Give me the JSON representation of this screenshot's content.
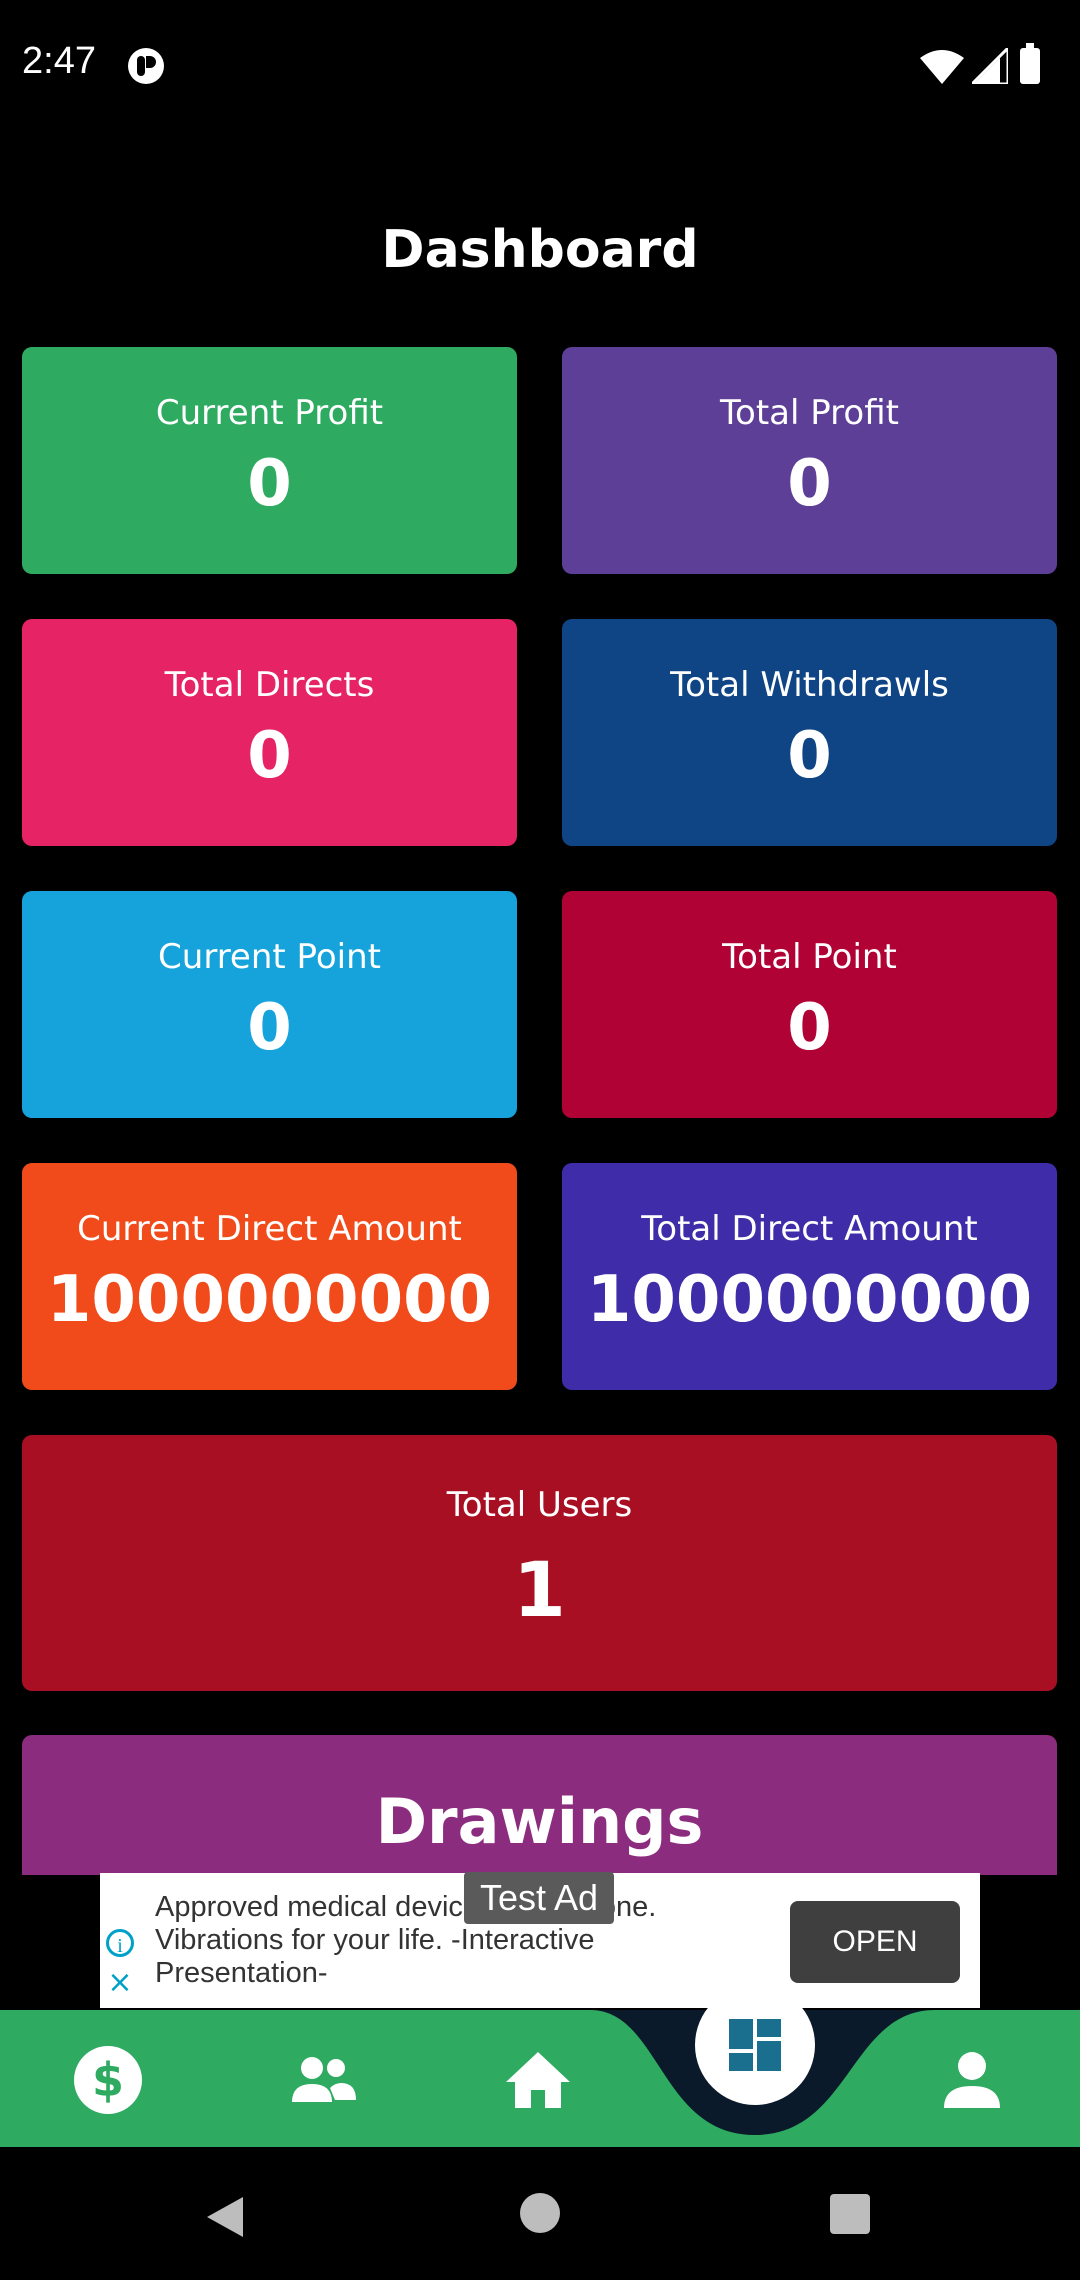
{
  "status_bar": {
    "time": "2:47"
  },
  "page": {
    "title": "Dashboard"
  },
  "cards": {
    "current_profit": {
      "label": "Current Profit",
      "value": "0",
      "color": "#2EAA61"
    },
    "total_profit": {
      "label": "Total Profit",
      "value": "0",
      "color": "#5E3F98"
    },
    "total_directs": {
      "label": "Total Directs",
      "value": "0",
      "color": "#E52365"
    },
    "total_withdrawls": {
      "label": "Total Withdrawls",
      "value": "0",
      "color": "#0F4585"
    },
    "current_point": {
      "label": "Current Point",
      "value": "0",
      "color": "#16A3DB"
    },
    "total_point": {
      "label": "Total Point",
      "value": "0",
      "color": "#B10236"
    },
    "current_direct_amount": {
      "label": "Current Direct Amount",
      "value": "1000000000",
      "color": "#F24B1B"
    },
    "total_direct_amount": {
      "label": "Total Direct Amount",
      "value": "1000000000",
      "color": "#3F2CA8"
    },
    "total_users": {
      "label": "Total Users",
      "value": "1",
      "color": "#A80F23"
    },
    "drawings": {
      "label": "Drawings",
      "color": "#8B2C7E"
    }
  },
  "ad": {
    "badge": "Test Ad",
    "text": "Approved medical device for everyone. Vibrations for your life. -Interactive Presentation-",
    "button_label": "OPEN"
  },
  "bottom_nav": {
    "items": [
      {
        "icon": "dollar-icon"
      },
      {
        "icon": "users-icon"
      },
      {
        "icon": "home-icon"
      },
      {
        "icon": "dashboard-icon",
        "selected": true
      },
      {
        "icon": "profile-icon"
      }
    ],
    "color": "#2EAA61"
  }
}
